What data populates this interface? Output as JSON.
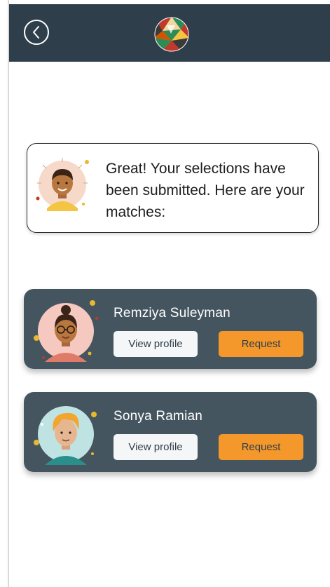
{
  "header": {
    "back_icon": "chevron-left-circle-icon",
    "logo_icon": "globe-logo-icon",
    "background_color": "#2f3e4b"
  },
  "message": {
    "text": "Great! Your selections have been submitted. Here are your matches:"
  },
  "matches": [
    {
      "name": "Remziya Suleyman",
      "view_label": "View profile",
      "request_label": "Request"
    },
    {
      "name": "Sonya Ramian",
      "view_label": "View profile",
      "request_label": "Request"
    }
  ],
  "colors": {
    "card": "#455560",
    "request_button": "#f5982b"
  }
}
